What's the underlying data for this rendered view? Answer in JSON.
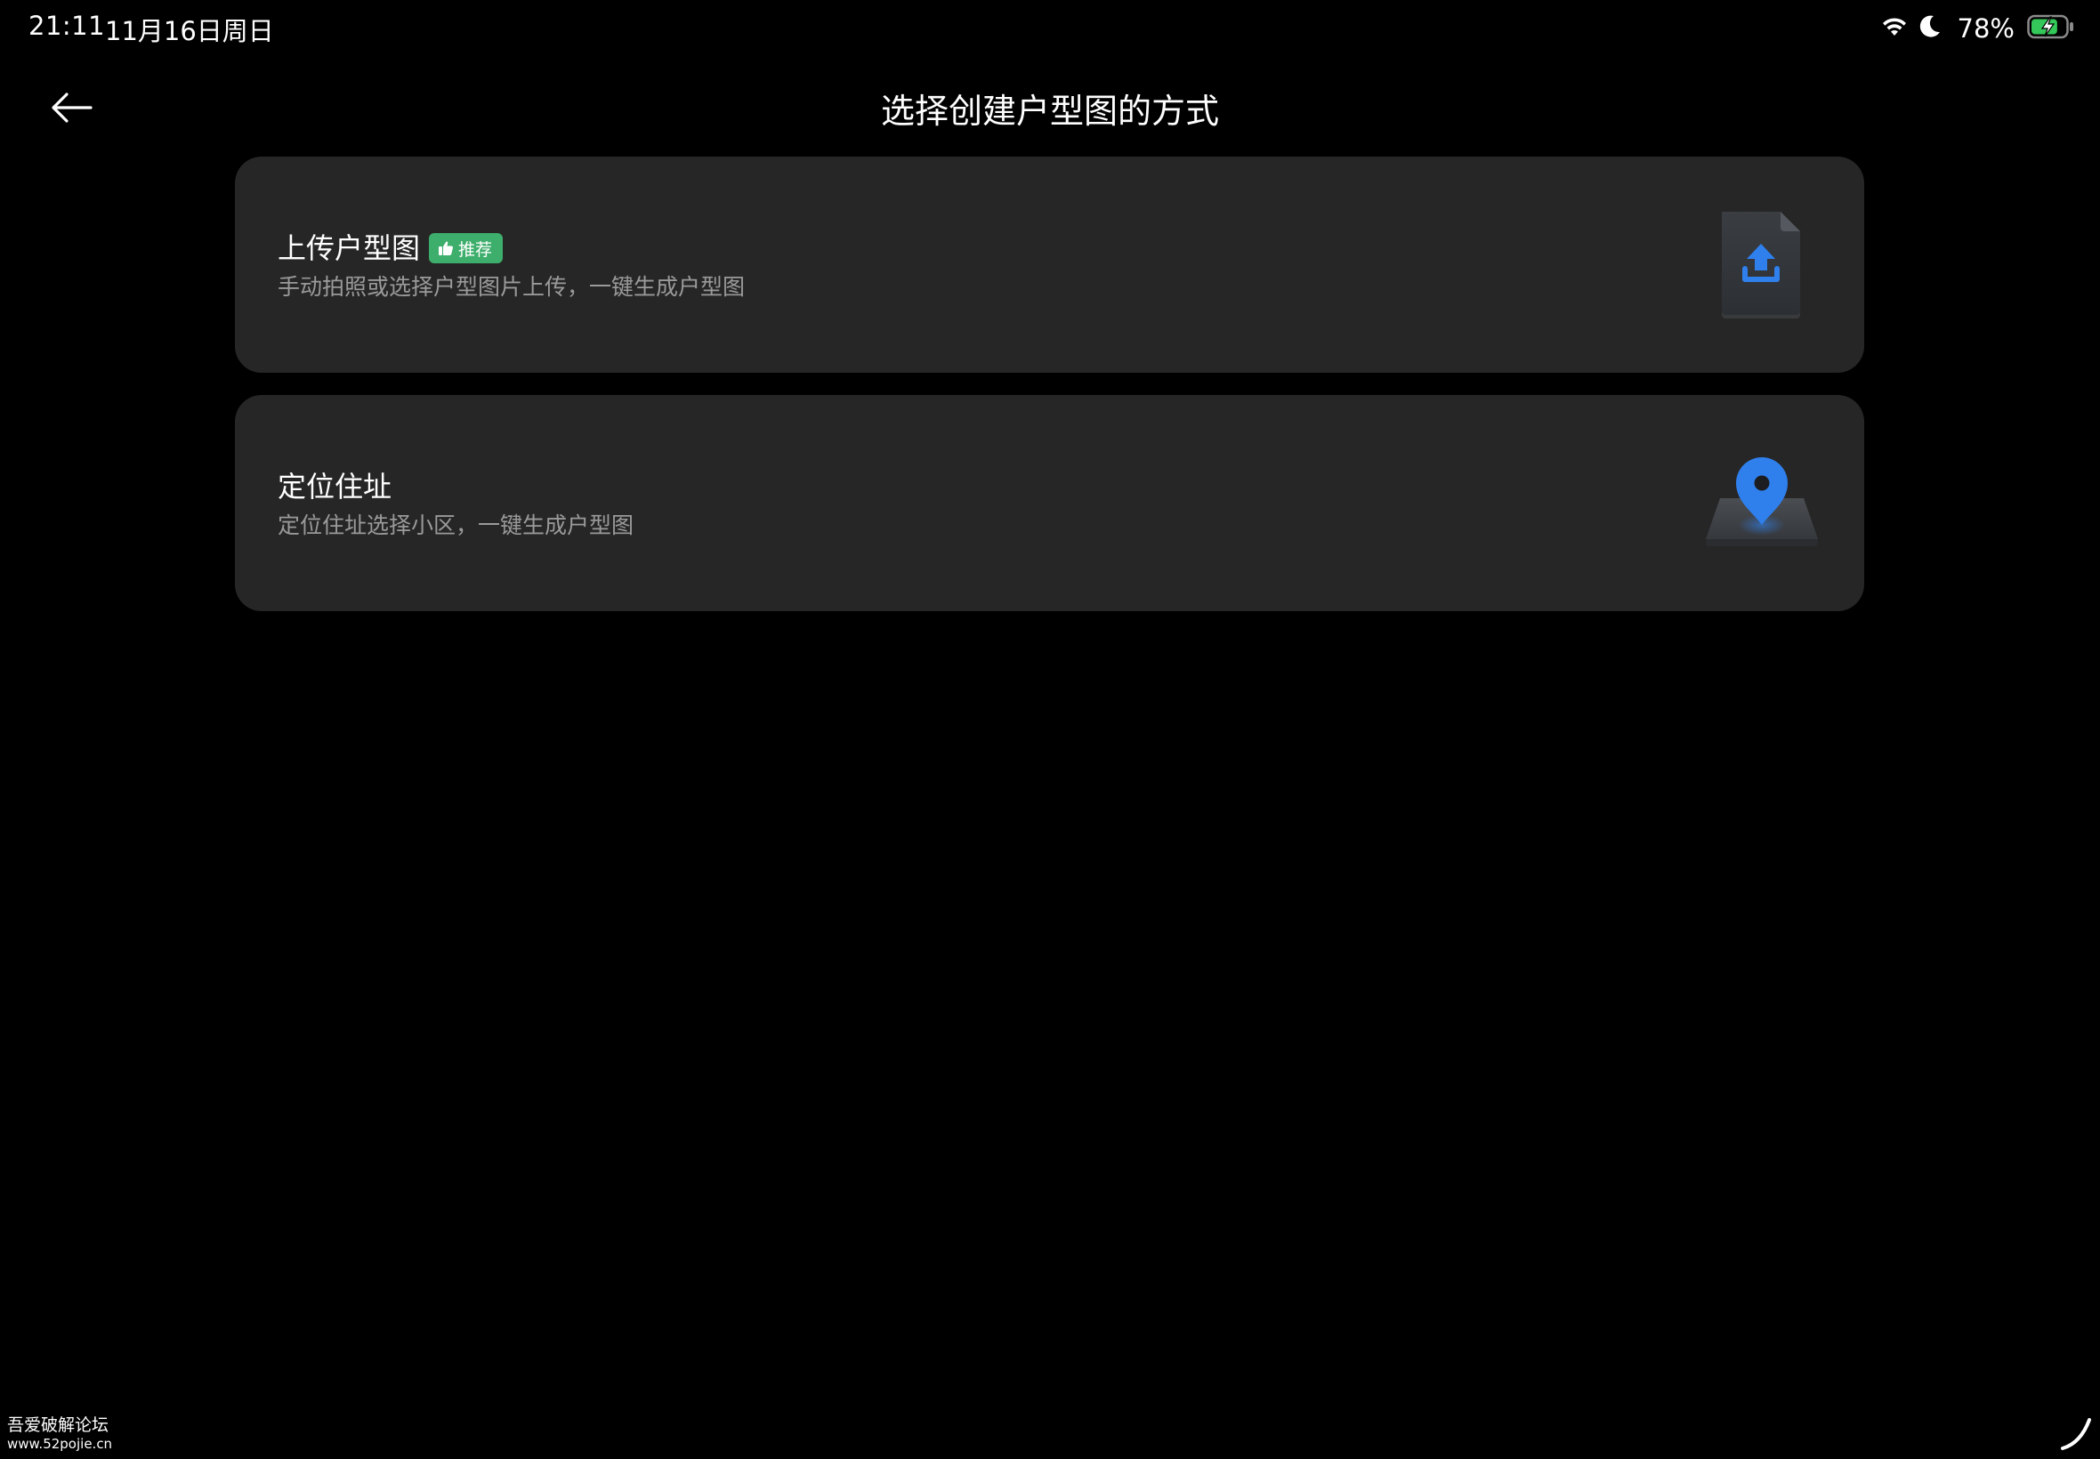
{
  "status_bar": {
    "time": "21:11",
    "date": "11月16日周日",
    "battery_percent": "78%",
    "battery_level": 0.78,
    "battery_color": "#34c759",
    "icons": [
      "wifi-icon",
      "moon-icon",
      "battery-charging-icon"
    ]
  },
  "header": {
    "title": "选择创建户型图的方式",
    "back_icon": "arrow-left-icon"
  },
  "options": [
    {
      "title": "上传户型图",
      "badge": "推荐",
      "badge_icon": "thumbs-up-icon",
      "badge_color": "#3dae6b",
      "description": "手动拍照或选择户型图片上传，一键生成户型图",
      "icon": "upload-file-icon"
    },
    {
      "title": "定位住址",
      "description": "定位住址选择小区，一键生成户型图",
      "icon": "location-pin-icon"
    }
  ],
  "watermark": {
    "line1": "吾爱破解论坛",
    "line2": "www.52pojie.cn"
  },
  "colors": {
    "background": "#000000",
    "card": "#262626",
    "accent_blue": "#2f80ed",
    "secondary_text": "#9a9a9a"
  }
}
